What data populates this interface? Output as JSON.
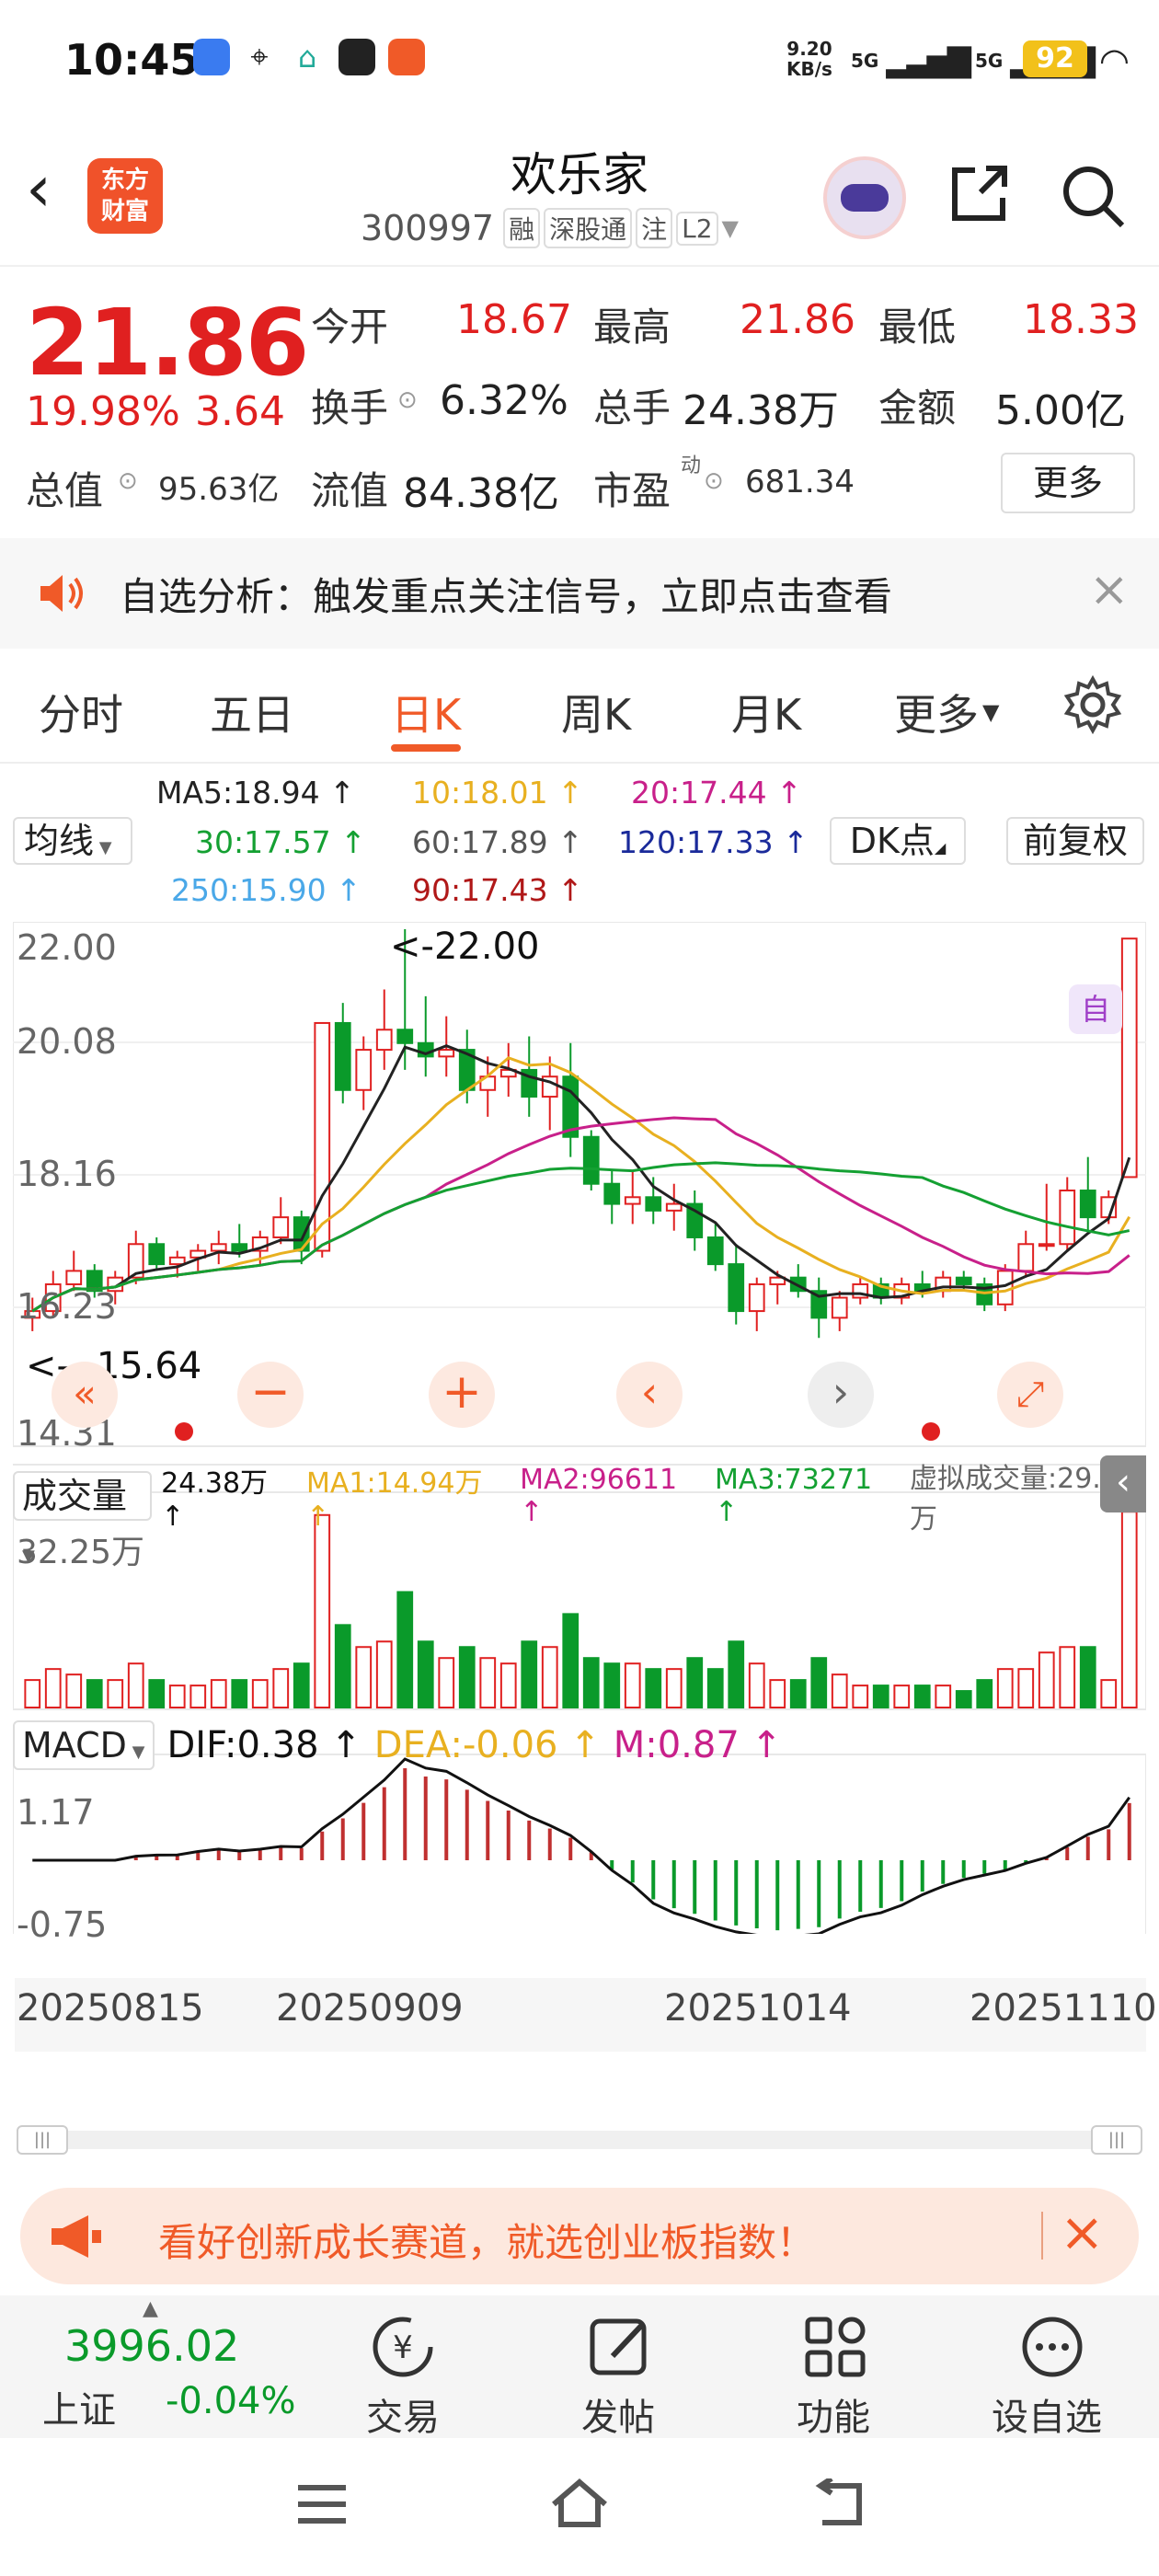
{
  "status_bar": {
    "time": "10:45",
    "net_speed_top": "9.20",
    "net_speed_bottom": "KB/s",
    "signal1": "5G",
    "signal2": "5G",
    "battery": "92"
  },
  "header": {
    "title": "欢乐家",
    "code": "300997",
    "tags": [
      "融",
      "深股通",
      "注",
      "L2"
    ],
    "logo_line1": "东方",
    "logo_line2": "财富"
  },
  "quote": {
    "price": "21.86",
    "change_pct": "19.98%",
    "change": "3.64",
    "fields": [
      {
        "label": "今开",
        "value": "18.67"
      },
      {
        "label": "最高",
        "value": "21.86"
      },
      {
        "label": "最低",
        "value": "18.33"
      },
      {
        "label": "换手",
        "value": "6.32%"
      },
      {
        "label": "总手",
        "value": "24.38万"
      },
      {
        "label": "金额",
        "value": "5.00亿"
      },
      {
        "label": "总值",
        "value": "95.63亿"
      },
      {
        "label": "流值",
        "value": "84.38亿"
      },
      {
        "label": "市盈",
        "value": "681.34",
        "sup": "动"
      }
    ],
    "more_button": "更多"
  },
  "notice": {
    "text": "自选分析：触发重点关注信号，立即点击查看"
  },
  "tabs": {
    "items": [
      "分时",
      "五日",
      "日K",
      "周K",
      "月K",
      "更多"
    ],
    "active": 2
  },
  "kline": {
    "indicator_select": "均线",
    "dk_button": "DK点",
    "adjust_button": "前复权",
    "ma_labels": [
      {
        "text": "MA5:18.94 ↑",
        "color": "#222222"
      },
      {
        "text": "10:18.01 ↑",
        "color": "#e8b020"
      },
      {
        "text": "20:17.44 ↑",
        "color": "#c8208a"
      },
      {
        "text": "30:17.57 ↑",
        "color": "#14a032"
      },
      {
        "text": "60:17.89 ↑",
        "color": "#555555"
      },
      {
        "text": "120:17.33 ↑",
        "color": "#1a2a9a"
      },
      {
        "text": "250:15.90 ↑",
        "color": "#4aa8e8"
      },
      {
        "text": "90:17.43 ↑",
        "color": "#b01818"
      }
    ],
    "price_ticks": [
      "22.00",
      "20.08",
      "18.16",
      "16.23",
      "14.31"
    ],
    "high_marker": "<-22.00",
    "low_marker": "<---15.64",
    "signal_tag": "自"
  },
  "volume": {
    "select": "成交量",
    "value": "24.38万 ↑",
    "ma1": "MA1:14.94万 ↑",
    "ma2": "MA2:96611 ↑",
    "ma3": "MA3:73271 ↑",
    "virtual": "虚拟成交量:29.04万",
    "axis_max": "32.25万"
  },
  "macd": {
    "select": "MACD",
    "dif": "DIF:0.38 ↑",
    "dea": "DEA:-0.06 ↑",
    "m": "M:0.87 ↑",
    "axis_max": "1.17",
    "axis_min": "-0.75"
  },
  "dates": [
    "20250815",
    "20250909",
    "20251014",
    "20251110"
  ],
  "chart_data": {
    "type": "candlestick",
    "ohlc_daily_approx": [
      [
        16.2,
        16.5,
        16.0,
        16.3
      ],
      [
        16.3,
        16.9,
        16.2,
        16.7
      ],
      [
        16.7,
        17.2,
        16.6,
        16.9
      ],
      [
        16.9,
        17.0,
        16.5,
        16.6
      ],
      [
        16.6,
        16.9,
        16.4,
        16.8
      ],
      [
        16.8,
        17.5,
        16.7,
        17.3
      ],
      [
        17.3,
        17.4,
        16.9,
        17.0
      ],
      [
        17.0,
        17.2,
        16.8,
        17.1
      ],
      [
        17.1,
        17.3,
        16.9,
        17.2
      ],
      [
        17.2,
        17.5,
        17.0,
        17.3
      ],
      [
        17.3,
        17.6,
        17.1,
        17.2
      ],
      [
        17.2,
        17.5,
        17.0,
        17.4
      ],
      [
        17.4,
        18.0,
        17.3,
        17.7
      ],
      [
        17.7,
        17.8,
        17.0,
        17.2
      ],
      [
        17.2,
        20.6,
        17.1,
        20.6
      ],
      [
        20.6,
        20.9,
        19.4,
        19.6
      ],
      [
        19.6,
        20.4,
        19.3,
        20.2
      ],
      [
        20.2,
        21.1,
        19.9,
        20.5
      ],
      [
        20.5,
        22.0,
        19.9,
        20.3
      ],
      [
        20.3,
        21.0,
        19.8,
        20.1
      ],
      [
        20.1,
        20.7,
        19.8,
        20.2
      ],
      [
        20.2,
        20.5,
        19.4,
        19.6
      ],
      [
        19.6,
        20.1,
        19.2,
        19.8
      ],
      [
        19.8,
        20.3,
        19.5,
        19.9
      ],
      [
        19.9,
        20.4,
        19.2,
        19.5
      ],
      [
        19.5,
        20.1,
        19.0,
        19.8
      ],
      [
        19.8,
        20.3,
        18.6,
        18.9
      ],
      [
        18.9,
        19.0,
        18.1,
        18.2
      ],
      [
        18.2,
        18.4,
        17.6,
        17.9
      ],
      [
        17.9,
        18.4,
        17.6,
        18.0
      ],
      [
        18.0,
        18.3,
        17.6,
        17.8
      ],
      [
        17.8,
        18.2,
        17.5,
        17.9
      ],
      [
        17.9,
        18.1,
        17.2,
        17.4
      ],
      [
        17.4,
        17.6,
        16.9,
        17.0
      ],
      [
        17.0,
        17.3,
        16.1,
        16.3
      ],
      [
        16.3,
        16.8,
        16.0,
        16.7
      ],
      [
        16.7,
        16.9,
        16.4,
        16.8
      ],
      [
        16.8,
        17.0,
        16.5,
        16.6
      ],
      [
        16.6,
        16.8,
        15.9,
        16.2
      ],
      [
        16.2,
        16.6,
        16.0,
        16.5
      ],
      [
        16.5,
        16.8,
        16.4,
        16.7
      ],
      [
        16.7,
        16.8,
        16.4,
        16.5
      ],
      [
        16.5,
        16.8,
        16.4,
        16.7
      ],
      [
        16.7,
        16.9,
        16.5,
        16.6
      ],
      [
        16.6,
        16.9,
        16.5,
        16.8
      ],
      [
        16.8,
        16.9,
        16.6,
        16.7
      ],
      [
        16.7,
        16.8,
        16.3,
        16.4
      ],
      [
        16.4,
        17.0,
        16.3,
        16.9
      ],
      [
        16.9,
        17.5,
        16.8,
        17.3
      ],
      [
        17.3,
        18.2,
        17.2,
        17.3
      ],
      [
        17.3,
        18.3,
        17.2,
        18.1
      ],
      [
        18.1,
        18.6,
        17.5,
        17.7
      ],
      [
        17.7,
        18.1,
        17.6,
        18.0
      ],
      [
        18.3,
        21.86,
        18.3,
        21.86
      ]
    ],
    "ylim": [
      14.31,
      22.0
    ]
  }
}
